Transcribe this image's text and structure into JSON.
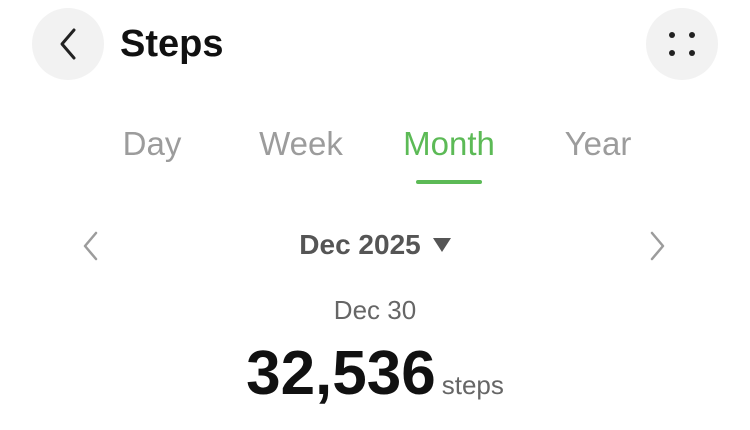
{
  "header": {
    "title": "Steps",
    "back_icon": "chevron-left-icon",
    "more_icon": "grid-dots-icon"
  },
  "tabs": [
    {
      "label": "Day",
      "active": false
    },
    {
      "label": "Week",
      "active": false
    },
    {
      "label": "Month",
      "active": true
    },
    {
      "label": "Year",
      "active": false
    }
  ],
  "period": {
    "label": "Dec 2025",
    "dropdown_icon": "caret-down-icon",
    "prev_icon": "chevron-left-icon",
    "next_icon": "chevron-right-icon"
  },
  "summary": {
    "date": "Dec 30",
    "value": "32,536",
    "unit": "steps"
  },
  "colors": {
    "accent": "#5cba56",
    "inactive_tab": "#9c9c9c",
    "button_bg": "#f2f2f2"
  }
}
